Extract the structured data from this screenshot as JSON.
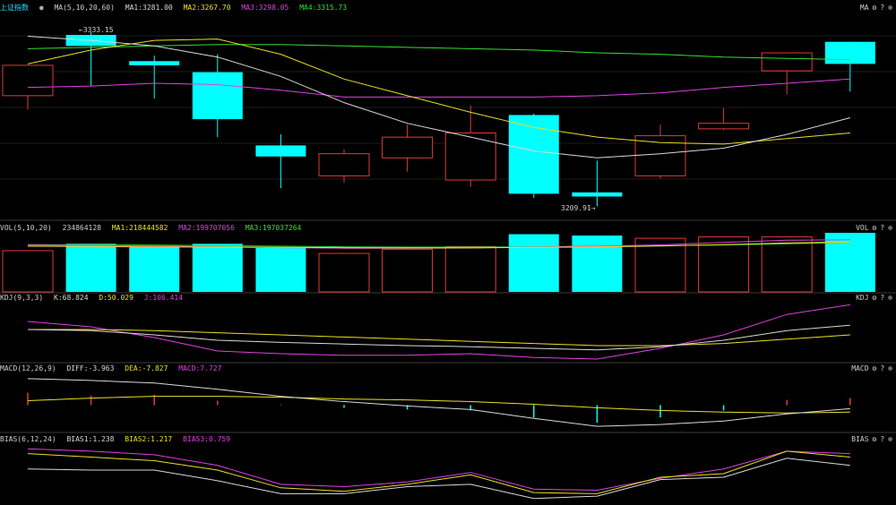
{
  "colors": {
    "up": "#e03a3a",
    "down": "#00ffff",
    "white": "#d8d8d8",
    "yellow": "#e8e020",
    "magenta": "#e040e0",
    "green": "#30e030"
  },
  "main": {
    "title": "上证指数",
    "ma_label": "MA(5,10,20,60)",
    "ma1": "MA1:3281.00",
    "ma2": "MA2:3267.70",
    "ma3": "MA3:3298.05",
    "ma4": "MA4:3315.73",
    "right_label": "MA",
    "high_label": "3333.15",
    "low_label": "3209.91"
  },
  "vol": {
    "label": "VOL(5,10,20)",
    "value": "234864128",
    "ma1": "MA1:218444582",
    "ma2": "MA2:199707056",
    "ma3": "MA3:197037264",
    "right_label": "VOL"
  },
  "kdj": {
    "label": "KDJ(9,3,3)",
    "k": "K:68.824",
    "d": "D:50.029",
    "j": "J:106.414",
    "right_label": "KDJ"
  },
  "macd": {
    "label": "MACD(12,26,9)",
    "diff": "DIFF:-3.963",
    "dea": "DEA:-7.827",
    "macd": "MACD:7.727",
    "right_label": "MACD"
  },
  "bias": {
    "label": "BIAS(6,12,24)",
    "b1": "BIAS1:1.238",
    "b2": "BIAS2:1.217",
    "b3": "BIAS3:0.759",
    "right_label": "BIAS"
  },
  "icons": [
    "gear-icon",
    "help-icon",
    "close-icon"
  ],
  "chart_data": {
    "type": "candlestick",
    "price_range": [
      3205,
      3345
    ],
    "candles": [
      {
        "o": 3290,
        "h": 3300,
        "l": 3280,
        "c": 3312,
        "dir": "up"
      },
      {
        "o": 3334,
        "h": 3336,
        "l": 3297,
        "c": 3326,
        "dir": "down"
      },
      {
        "o": 3315,
        "h": 3319,
        "l": 3288,
        "c": 3312,
        "dir": "down"
      },
      {
        "o": 3307,
        "h": 3320,
        "l": 3260,
        "c": 3273,
        "dir": "down"
      },
      {
        "o": 3254,
        "h": 3262,
        "l": 3223,
        "c": 3246,
        "dir": "down"
      },
      {
        "o": 3232,
        "h": 3251,
        "l": 3227,
        "c": 3248,
        "dir": "up"
      },
      {
        "o": 3245,
        "h": 3269,
        "l": 3235,
        "c": 3260,
        "dir": "up"
      },
      {
        "o": 3229,
        "h": 3283,
        "l": 3224,
        "c": 3263,
        "dir": "up"
      },
      {
        "o": 3276,
        "h": 3277,
        "l": 3216,
        "c": 3219,
        "dir": "down"
      },
      {
        "o": 3220,
        "h": 3243,
        "l": 3209.91,
        "c": 3217,
        "dir": "down"
      },
      {
        "o": 3232,
        "h": 3269,
        "l": 3230,
        "c": 3261,
        "dir": "up"
      },
      {
        "o": 3266,
        "h": 3281,
        "l": 3265,
        "c": 3270,
        "dir": "up"
      },
      {
        "o": 3308,
        "h": 3319,
        "l": 3291,
        "c": 3321,
        "dir": "up"
      },
      {
        "o": 3329,
        "h": 3328,
        "l": 3293,
        "c": 3313,
        "dir": "down"
      }
    ],
    "ma1": [
      3333,
      3330,
      3326,
      3318,
      3304,
      3285,
      3270,
      3260,
      3250,
      3245,
      3248,
      3252,
      3262,
      3274
    ],
    "ma2": [
      3313,
      3323,
      3330,
      3331,
      3320,
      3302,
      3290,
      3278,
      3267,
      3260,
      3256,
      3255,
      3259,
      3263
    ],
    "ma3": [
      3296,
      3297,
      3299,
      3298,
      3294,
      3289,
      3289,
      3289,
      3289,
      3290,
      3292,
      3296,
      3299,
      3302
    ],
    "ma4": [
      3324,
      3325,
      3326,
      3327,
      3327,
      3326,
      3325,
      3324,
      3323,
      3321,
      3320,
      3318,
      3317,
      3316
    ],
    "volume": [
      150,
      175,
      165,
      175,
      160,
      140,
      155,
      165,
      210,
      205,
      195,
      200,
      200,
      215
    ],
    "vol_dir": [
      "up",
      "down",
      "down",
      "down",
      "down",
      "up",
      "up",
      "up",
      "down",
      "down",
      "up",
      "up",
      "up",
      "down"
    ],
    "vol_ma1": [
      166,
      165,
      164,
      163,
      162,
      161,
      160,
      160,
      162,
      164,
      167,
      172,
      178,
      182
    ],
    "vol_ma2": [
      170,
      169,
      167,
      164,
      161,
      159,
      159,
      160,
      163,
      166,
      171,
      180,
      188,
      190
    ],
    "vol_ma3": [
      172,
      171,
      170,
      168,
      166,
      164,
      163,
      163,
      164,
      166,
      168,
      171,
      175,
      180
    ],
    "kdj_k": [
      60,
      58,
      50,
      40,
      36,
      33,
      30,
      28,
      25,
      22,
      28,
      40,
      58,
      68
    ],
    "kdj_d": [
      60,
      60,
      58,
      54,
      50,
      46,
      42,
      38,
      34,
      30,
      30,
      34,
      42,
      50
    ],
    "kdj_j": [
      75,
      65,
      45,
      20,
      15,
      12,
      12,
      15,
      8,
      5,
      25,
      50,
      88,
      106
    ],
    "macd_diff": [
      30,
      28,
      25,
      18,
      10,
      4,
      -1,
      -5,
      -15,
      -24,
      -22,
      -18,
      -10,
      -4
    ],
    "macd_dea": [
      5,
      8,
      10,
      10,
      9,
      7,
      6,
      4,
      1,
      -3,
      -6,
      -8,
      -9,
      -8
    ],
    "macd_hist": [
      14,
      11,
      12,
      5,
      1,
      -3,
      -5,
      -6,
      -14,
      -20,
      -14,
      -6,
      6,
      8
    ],
    "bias1": [
      -0.5,
      -0.6,
      -0.6,
      -1.5,
      -2.6,
      -2.6,
      -2.0,
      -1.8,
      -3.0,
      -2.8,
      -1.4,
      -1.2,
      0.4,
      -0.2
    ],
    "bias2": [
      0.8,
      0.5,
      0.2,
      -0.6,
      -2.1,
      -2.4,
      -1.8,
      -1.0,
      -2.5,
      -2.6,
      -1.2,
      -0.9,
      1.0,
      0.5
    ],
    "bias3": [
      1.2,
      1.0,
      0.7,
      -0.2,
      -1.8,
      -2.0,
      -1.6,
      -0.8,
      -2.2,
      -2.3,
      -1.3,
      -0.5,
      1.0,
      0.8
    ]
  }
}
